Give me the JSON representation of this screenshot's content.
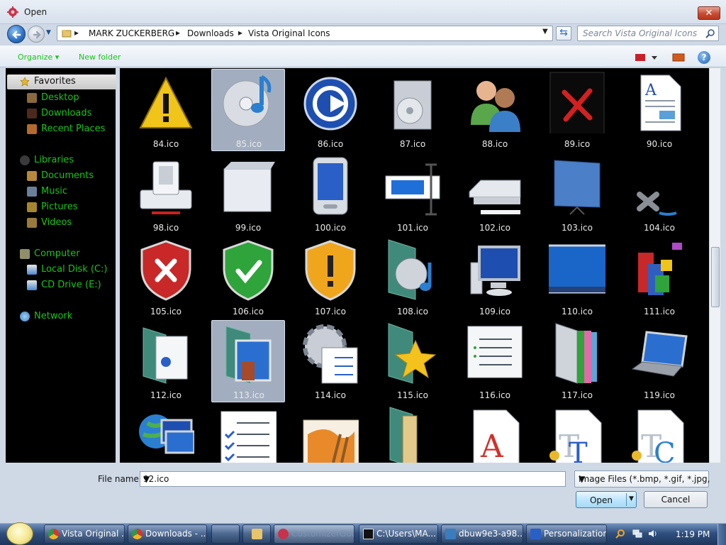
{
  "window": {
    "title": "Open",
    "close_label": "✕"
  },
  "address": {
    "breadcrumbs": [
      "MARK ZUCKERBERG",
      "Downloads",
      "Vista Original Icons"
    ],
    "separator": "▸",
    "refresh_label": "⇆"
  },
  "search": {
    "placeholder": "Search Vista Original Icons"
  },
  "toolbar": {
    "organize_label": "Organize ▾",
    "new_folder_label": "New folder",
    "help_label": "?"
  },
  "nav": {
    "favorites": {
      "label": "Favorites",
      "items": [
        "Desktop",
        "Downloads",
        "Recent Places"
      ]
    },
    "libraries": {
      "label": "Libraries",
      "items": [
        "Documents",
        "Music",
        "Pictures",
        "Videos"
      ]
    },
    "computer": {
      "label": "Computer",
      "items": [
        "Local Disk (C:)",
        "CD Drive (E:)"
      ]
    },
    "network": {
      "label": "Network"
    }
  },
  "files": {
    "rows": [
      [
        "84.ico",
        "85.ico",
        "86.ico",
        "87.ico",
        "88.ico",
        "89.ico",
        "90.ico"
      ],
      [
        "98.ico",
        "99.ico",
        "100.ico",
        "101.ico",
        "102.ico",
        "103.ico",
        "104.ico"
      ],
      [
        "105.ico",
        "106.ico",
        "107.ico",
        "108.ico",
        "109.ico",
        "110.ico",
        "111.ico"
      ],
      [
        "112.ico",
        "113.ico",
        "114.ico",
        "115.ico",
        "116.ico",
        "117.ico",
        "119.ico"
      ]
    ],
    "selected": "85.ico",
    "hovered": "113.ico"
  },
  "bottom": {
    "file_name_label": "File name:",
    "file_name_value": "92.ico",
    "file_type": "Image Files (*.bmp, *.gif, *.jpg,",
    "open_label": "Open",
    "cancel_label": "Cancel"
  },
  "taskbar": {
    "items": [
      {
        "label": "Vista Original ...",
        "icon": "chrome-icon",
        "state": "normal"
      },
      {
        "label": "Downloads - ...",
        "icon": "chrome-icon",
        "state": "normal"
      },
      {
        "label": "",
        "icon": "firefox-icon",
        "state": "normal"
      },
      {
        "label": "",
        "icon": "explorer-icon",
        "state": "normal"
      },
      {
        "label": "CustomizerGod",
        "icon": "customizergod-icon",
        "state": "active"
      },
      {
        "label": "C:\\Users\\MA...",
        "icon": "7zip-icon",
        "state": "normal"
      },
      {
        "label": "dbuw9e3-a98...",
        "icon": "folder-icon",
        "state": "normal"
      },
      {
        "label": "Personalization",
        "icon": "personalization-icon",
        "state": "normal"
      }
    ],
    "clock": "1:19 PM"
  },
  "colors": {
    "nav_text": "#19c419",
    "pane_bg": "#000000",
    "caption": "#eaeaea"
  }
}
